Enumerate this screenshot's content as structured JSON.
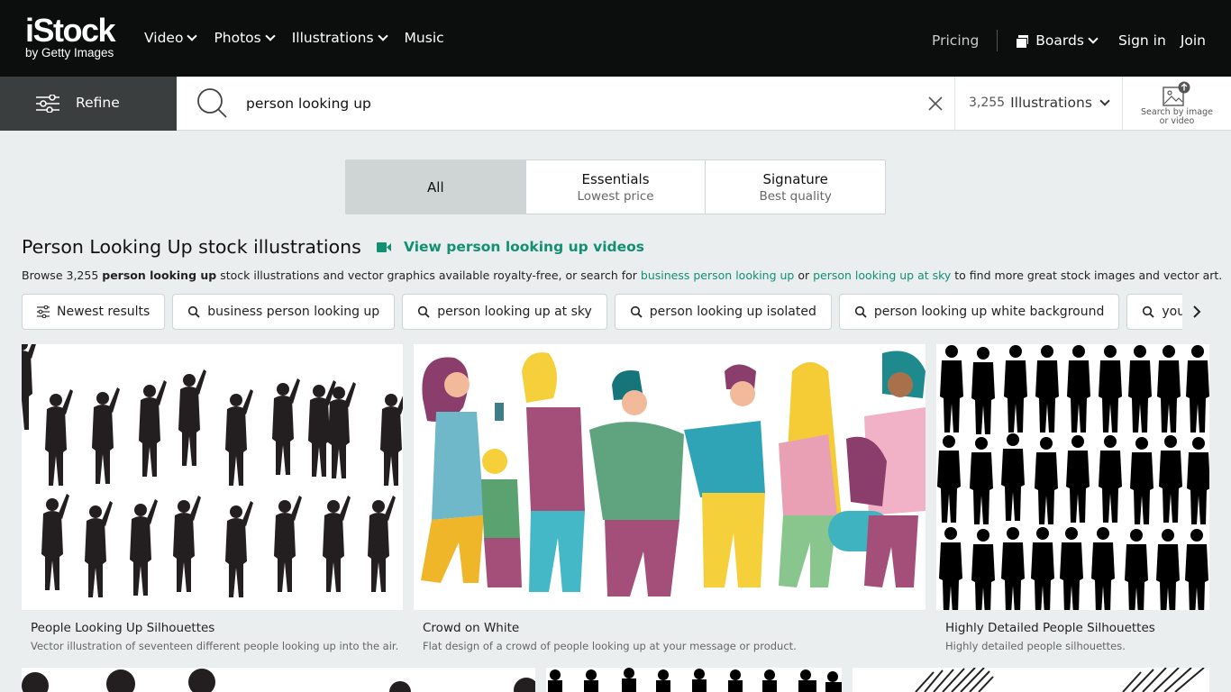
{
  "header": {
    "logo_main": "iStock",
    "logo_sub": "by Getty Images",
    "nav": [
      {
        "label": "Video",
        "has_menu": true
      },
      {
        "label": "Photos",
        "has_menu": true
      },
      {
        "label": "Illustrations",
        "has_menu": true
      },
      {
        "label": "Music",
        "has_menu": false
      }
    ],
    "pricing": "Pricing",
    "boards": "Boards",
    "signin": "Sign in",
    "join": "Join"
  },
  "search": {
    "refine_label": "Refine",
    "query": "person looking up",
    "result_count": "3,255",
    "media_type": "Illustrations",
    "search_by_image_line1": "Search by image",
    "search_by_image_line2": "or video"
  },
  "tabs": [
    {
      "title": "All",
      "subtitle": "",
      "active": true
    },
    {
      "title": "Essentials",
      "subtitle": "Lowest price",
      "active": false
    },
    {
      "title": "Signature",
      "subtitle": "Best quality",
      "active": false
    }
  ],
  "results_header": {
    "title": "Person Looking Up stock illustrations",
    "video_link": "View person looking up videos",
    "browse_prefix": "Browse 3,255 ",
    "browse_bold": "person looking up",
    "browse_mid": " stock illustrations and vector graphics available royalty-free, or search for ",
    "browse_link1": "business person looking up",
    "browse_or": " or ",
    "browse_link2": "person looking up at sky",
    "browse_suffix": " to find more great stock images and vector art."
  },
  "chips": [
    {
      "label": "Newest results",
      "icon": "sliders-icon"
    },
    {
      "label": "business person looking up",
      "icon": "search-icon"
    },
    {
      "label": "person looking up at sky",
      "icon": "search-icon"
    },
    {
      "label": "person looking up isolated",
      "icon": "search-icon"
    },
    {
      "label": "person looking up white background",
      "icon": "search-icon"
    },
    {
      "label": "young person looking up",
      "icon": "search-icon"
    }
  ],
  "results": [
    {
      "title": "People Looking Up Silhouettes",
      "description": "Vector illustration of seventeen different people looking up into the air."
    },
    {
      "title": "Crowd on White",
      "description": "Flat design of a crowd of people looking up at your message or product."
    },
    {
      "title": "Highly Detailed People Silhouettes",
      "description": "Highly detailed people silhouettes."
    }
  ],
  "colors": {
    "topbar": "#0c0d0d",
    "accent_green": "#138f74",
    "refine_bg": "#3a3e3e",
    "page_bg": "#eaeeee"
  }
}
